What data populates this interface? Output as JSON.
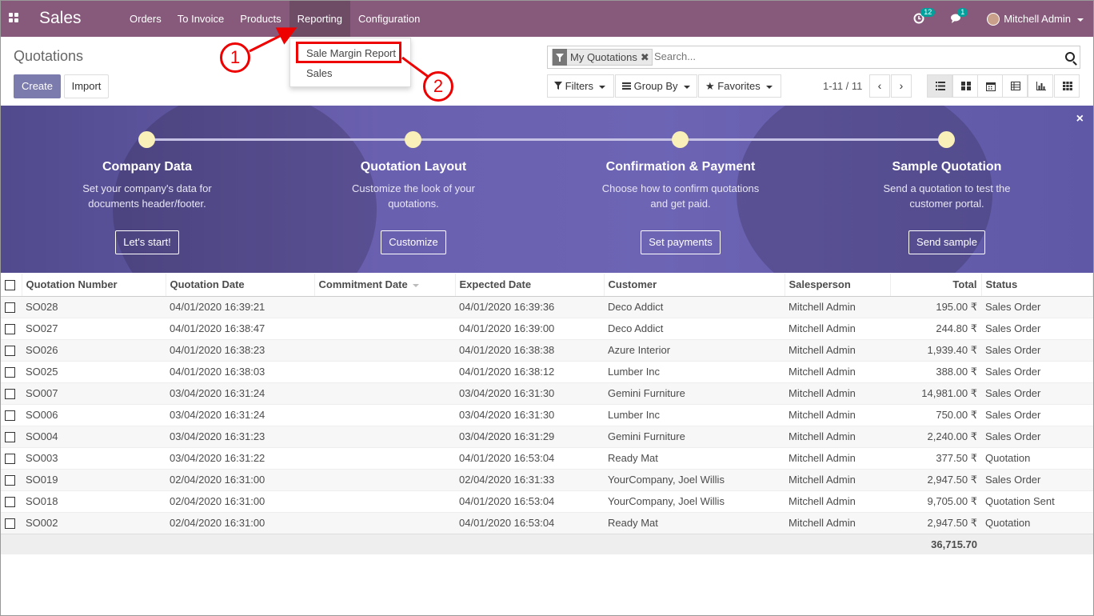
{
  "navbar": {
    "brand": "Sales",
    "menu": [
      "Orders",
      "To Invoice",
      "Products",
      "Reporting",
      "Configuration"
    ],
    "activity_badge": "12",
    "message_badge": "1",
    "user": "Mitchell Admin"
  },
  "dropdown": {
    "items": [
      "Sale Margin Report",
      "Sales"
    ]
  },
  "callouts": [
    "1",
    "2"
  ],
  "control_panel": {
    "title": "Quotations",
    "create_label": "Create",
    "import_label": "Import",
    "facet_label": "My Quotations",
    "facet_remove": "✖",
    "search_placeholder": "Search...",
    "filters_label": "Filters",
    "groupby_label": "Group By",
    "favorites_label": "Favorites",
    "pager": "1-11 / 11",
    "prev": "‹",
    "next": "›"
  },
  "banner": {
    "close": "×",
    "steps": [
      {
        "title": "Company Data",
        "desc1": "Set your company's data for",
        "desc2": "documents header/footer.",
        "button": "Let's start!"
      },
      {
        "title": "Quotation Layout",
        "desc1": "Customize the look of your",
        "desc2": "quotations.",
        "button": "Customize"
      },
      {
        "title": "Confirmation & Payment",
        "desc1": "Choose how to confirm quotations",
        "desc2": "and get paid.",
        "button": "Set payments"
      },
      {
        "title": "Sample Quotation",
        "desc1": "Send a quotation to test the",
        "desc2": "customer portal.",
        "button": "Send sample"
      }
    ]
  },
  "table": {
    "headers": [
      "Quotation Number",
      "Quotation Date",
      "Commitment Date",
      "Expected Date",
      "Customer",
      "Salesperson",
      "Total",
      "Status"
    ],
    "rows": [
      [
        "SO028",
        "04/01/2020 16:39:21",
        "",
        "04/01/2020 16:39:36",
        "Deco Addict",
        "Mitchell Admin",
        "195.00 ₹",
        "Sales Order"
      ],
      [
        "SO027",
        "04/01/2020 16:38:47",
        "",
        "04/01/2020 16:39:00",
        "Deco Addict",
        "Mitchell Admin",
        "244.80 ₹",
        "Sales Order"
      ],
      [
        "SO026",
        "04/01/2020 16:38:23",
        "",
        "04/01/2020 16:38:38",
        "Azure Interior",
        "Mitchell Admin",
        "1,939.40 ₹",
        "Sales Order"
      ],
      [
        "SO025",
        "04/01/2020 16:38:03",
        "",
        "04/01/2020 16:38:12",
        "Lumber Inc",
        "Mitchell Admin",
        "388.00 ₹",
        "Sales Order"
      ],
      [
        "SO007",
        "03/04/2020 16:31:24",
        "",
        "03/04/2020 16:31:30",
        "Gemini Furniture",
        "Mitchell Admin",
        "14,981.00 ₹",
        "Sales Order"
      ],
      [
        "SO006",
        "03/04/2020 16:31:24",
        "",
        "03/04/2020 16:31:30",
        "Lumber Inc",
        "Mitchell Admin",
        "750.00 ₹",
        "Sales Order"
      ],
      [
        "SO004",
        "03/04/2020 16:31:23",
        "",
        "03/04/2020 16:31:29",
        "Gemini Furniture",
        "Mitchell Admin",
        "2,240.00 ₹",
        "Sales Order"
      ],
      [
        "SO003",
        "03/04/2020 16:31:22",
        "",
        "04/01/2020 16:53:04",
        "Ready Mat",
        "Mitchell Admin",
        "377.50 ₹",
        "Quotation"
      ],
      [
        "SO019",
        "02/04/2020 16:31:00",
        "",
        "02/04/2020 16:31:33",
        "YourCompany, Joel Willis",
        "Mitchell Admin",
        "2,947.50 ₹",
        "Sales Order"
      ],
      [
        "SO018",
        "02/04/2020 16:31:00",
        "",
        "04/01/2020 16:53:04",
        "YourCompany, Joel Willis",
        "Mitchell Admin",
        "9,705.00 ₹",
        "Quotation Sent"
      ],
      [
        "SO002",
        "02/04/2020 16:31:00",
        "",
        "04/01/2020 16:53:04",
        "Ready Mat",
        "Mitchell Admin",
        "2,947.50 ₹",
        "Quotation"
      ]
    ],
    "footer_total": "36,715.70"
  },
  "colors": {
    "navbar": "#875A7B",
    "primary": "#7C7BAD",
    "annotation": "#EE0000",
    "badge": "#00A09D"
  }
}
